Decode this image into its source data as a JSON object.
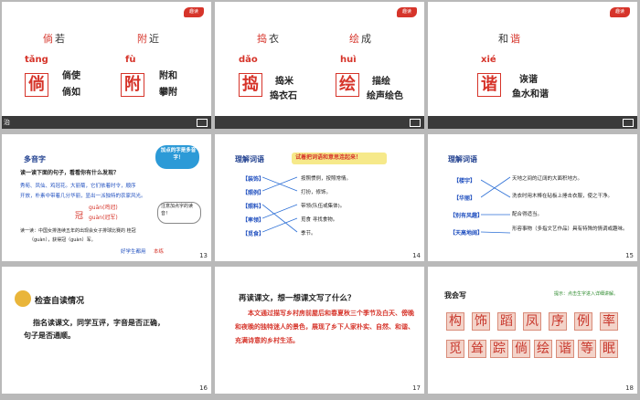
{
  "slide1": {
    "badge": "趣读",
    "pair1": [
      "倘",
      "若"
    ],
    "pair2": [
      "附",
      "近"
    ],
    "pinyin1": "tǎng",
    "box1": "倘",
    "words1": [
      "倘使",
      "倘如"
    ],
    "pinyin2": "fù",
    "box2": "附",
    "words2": [
      "附和",
      "攀附"
    ],
    "footer": "治"
  },
  "slide2": {
    "badge": "趣读",
    "pair1": [
      "捣",
      "衣"
    ],
    "pair2": [
      "绘",
      "成"
    ],
    "pinyin1": "dǎo",
    "box1": "捣",
    "words1": [
      "捣米",
      "捣衣石"
    ],
    "pinyin2": "huì",
    "box2": "绘",
    "words2": [
      "描绘",
      "绘声绘色"
    ]
  },
  "slide3": {
    "badge": "趣读",
    "pair": [
      "和",
      "谐"
    ],
    "pinyin": "xié",
    "box": "谐",
    "words": [
      "诙谐",
      "鱼水和谐"
    ]
  },
  "slide4": {
    "title": "多音字",
    "bubble": "加点的字是多音字！",
    "line1": "读一读下面的句子，看看你有什么发现？",
    "line2": "秀荀、凤仙、鸡冠花。大丽菊，它们依着时令，顺序",
    "line3": "开放，朴素中带着几分华丽，显出一派独特的农家风光。",
    "guan_label": "冠",
    "guan1": "guān(鸡冠)",
    "guan2": "guàn(冠军)",
    "note": "注意加点字的读音！",
    "line4": "读一读：中国女排连续五年的出现会女子排球比赛的 桂冠",
    "line5": "（guàn），获得冠（guàn）军。",
    "brand": "好学生都用",
    "brand2": "本练",
    "page": "13"
  },
  "slide5": {
    "title": "理解词语",
    "banner": "试着把词语和意思连起来！",
    "terms": [
      "【装饰】",
      "【照例】",
      "【照料】",
      "【率领】",
      "【觅食】"
    ],
    "defs": [
      "按照惯例，按照常情。",
      "打扮，修饰。",
      "带领(队伍或集体)。",
      "觅食 寻找食物。",
      "季节。"
    ],
    "page": "14"
  },
  "slide6": {
    "title": "理解词语",
    "terms": [
      "【楼宇】",
      "【华丽】",
      "【别有风趣】",
      "【天高地阔】"
    ],
    "defs": [
      "天地之间的辽阔的大面积地方。",
      "洗衣时用木棒在砧板上捶击衣服，使之干净。",
      "配合得适当。",
      "形容事物（多指文艺作品）具有特殊的情调或趣味。"
    ],
    "page": "15"
  },
  "slide7": {
    "title": "检查自读情况",
    "line1": "指名读课文，同学互评，字音是否正确，",
    "line2": "句子是否通顺。",
    "page": "16"
  },
  "slide8": {
    "title": "再读课文，想一想课文写了什么？",
    "body": "本文通过描写乡村房前屋后和春夏秋三个季节及白天、傍晚和夜晚的独特迷人的景色，展现了乡下人家朴实、自然、和谐、充满诗意的乡村生活。",
    "page": "17"
  },
  "slide9": {
    "title": "我会写",
    "tip": "提示：点击生字进入详细讲解。",
    "row1": [
      "构",
      "饰",
      "蹈",
      "凤",
      "序",
      "例",
      "率"
    ],
    "row2": [
      "觅",
      "耸",
      "踪",
      "倘",
      "绘",
      "谐",
      "等",
      "眠"
    ],
    "page": "18"
  }
}
